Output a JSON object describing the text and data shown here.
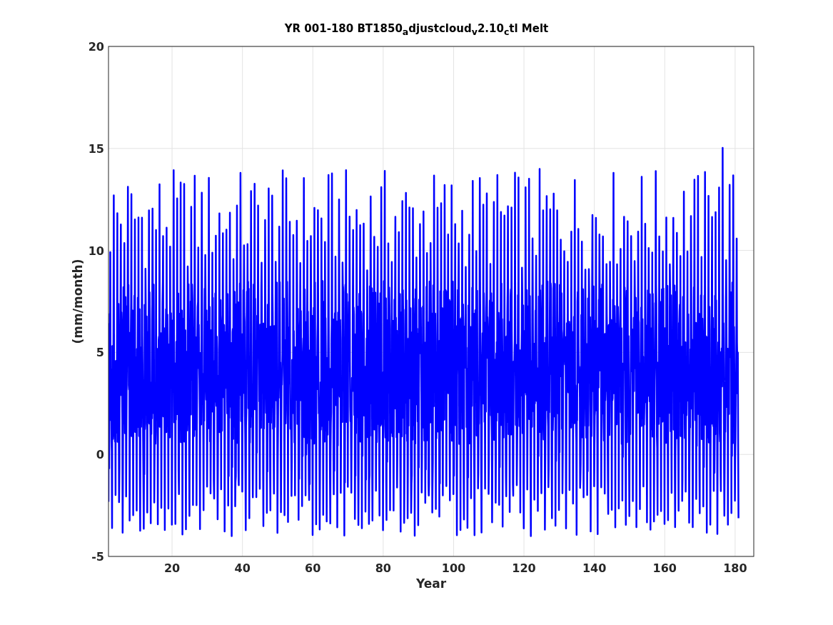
{
  "figure": {
    "title": "YR 001-180 BT1850$_{a}$djustcloud$_{v}$2.10$_{c}$tl Melt",
    "xlabel": "Year",
    "ylabel": "(mm/month)",
    "xticks": [
      "20",
      "40",
      "60",
      "80",
      "100",
      "120",
      "140",
      "160",
      "180"
    ],
    "yticks": [
      "20",
      "15",
      "10",
      "5",
      "0",
      "-5"
    ]
  }
}
